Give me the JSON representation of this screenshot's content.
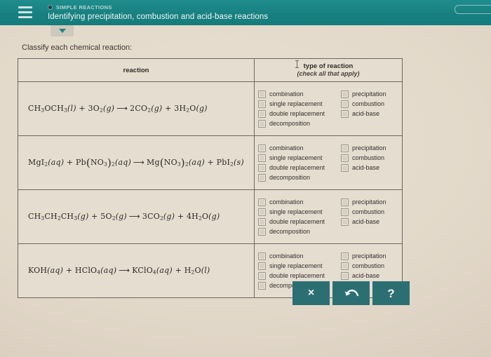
{
  "header": {
    "menu_icon": "hamburger-icon",
    "kicker_icon": "record-dot-icon",
    "kicker": "SIMPLE REACTIONS",
    "title": "Identifying precipitation, combustion and acid-base reactions",
    "pill_icon": "rounded-pill-outline"
  },
  "tab_toggle": {
    "icon": "caret-down-icon"
  },
  "prompt": "Classify each chemical reaction:",
  "table": {
    "headers": {
      "reaction": "reaction",
      "type_main": "type of reaction",
      "type_sub": "(check all that apply)"
    },
    "option_labels": {
      "combination": "combination",
      "single_replacement": "single replacement",
      "double_replacement": "double replacement",
      "decomposition": "decomposition",
      "precipitation": "precipitation",
      "combustion": "combustion",
      "acid_base": "acid-base"
    },
    "rows": [
      {
        "equation_plain": "CH3OCH3(l) + 3O2(g) → 2CO2(g) + 3H2O(g)",
        "equation_html": "CH<sub>3</sub>OCH<sub>3</sub><span class=\"it\">(l)</span> + 3O<sub>2</sub><span class=\"it\">(g)</span><span class=\"arrow\">⟶</span>2CO<sub>2</sub><span class=\"it\">(g)</span> + 3H<sub>2</sub>O<span class=\"it\">(g)</span>"
      },
      {
        "equation_plain": "MgI2(aq) + Pb(NO3)2(aq) → Mg(NO3)2(aq) + PbI2(s)",
        "equation_html": "MgI<sub>2</sub><span class=\"it\">(aq)</span> + Pb<span class=\"big-paren\">(</span>NO<sub>3</sub><span class=\"big-paren\">)</span><sub>2</sub><span class=\"it\">(aq)</span><span class=\"arrow\">⟶</span>Mg<span class=\"big-paren\">(</span>NO<sub>3</sub><span class=\"big-paren\">)</span><sub>2</sub><span class=\"it\">(aq)</span> + PbI<sub>2</sub><span class=\"it\">(s)</span>"
      },
      {
        "equation_plain": "CH3CH2CH3(g) + 5O2(g) → 3CO2(g) + 4H2O(g)",
        "equation_html": "CH<sub>3</sub>CH<sub>2</sub>CH<sub>3</sub><span class=\"it\">(g)</span> + 5O<sub>2</sub><span class=\"it\">(g)</span><span class=\"arrow\">⟶</span>3CO<sub>2</sub><span class=\"it\">(g)</span> + 4H<sub>2</sub>O<span class=\"it\">(g)</span>"
      },
      {
        "equation_plain": "KOH(aq) + HClO4(aq) → KClO4(aq) + H2O(l)",
        "equation_html": "KOH<span class=\"it\">(aq)</span> + HClO<sub>4</sub><span class=\"it\">(aq)</span><span class=\"arrow\">⟶</span>KClO<sub>4</sub><span class=\"it\">(aq)</span> + H<sub>2</sub>O<span class=\"it\">(l)</span>"
      }
    ]
  },
  "actions": [
    {
      "name": "clear-button",
      "icon": "close-x-icon",
      "label": "×"
    },
    {
      "name": "undo-button",
      "icon": "undo-arrow-icon",
      "label": ""
    },
    {
      "name": "help-button",
      "icon": "question-mark-icon",
      "label": "?"
    }
  ],
  "colors": {
    "header_teal": "#17807f",
    "button_teal": "#2c6f73",
    "page_background": "#e3d9ca",
    "table_background": "#e6ddd1",
    "border": "#6d665c"
  }
}
